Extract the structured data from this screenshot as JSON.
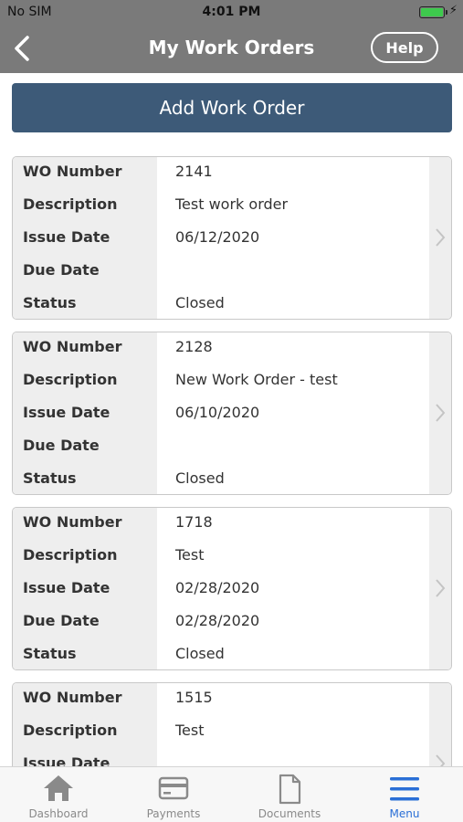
{
  "status_bar": {
    "carrier": "No SIM",
    "time": "4:01 PM",
    "charging_icon": "bolt-icon"
  },
  "nav": {
    "back_icon": "chevron-left-icon",
    "title": "My Work Orders",
    "help_label": "Help"
  },
  "add_button_label": "Add Work Order",
  "field_labels": {
    "wo_number": "WO Number",
    "description": "Description",
    "issue_date": "Issue Date",
    "due_date": "Due Date",
    "status": "Status"
  },
  "work_orders": [
    {
      "wo_number": "2141",
      "description": "Test work order",
      "issue_date": "06/12/2020",
      "due_date": "",
      "status": "Closed"
    },
    {
      "wo_number": "2128",
      "description": "New Work Order - test",
      "issue_date": "06/10/2020",
      "due_date": "",
      "status": "Closed"
    },
    {
      "wo_number": "1718",
      "description": "Test",
      "issue_date": "02/28/2020",
      "due_date": "02/28/2020",
      "status": "Closed"
    },
    {
      "wo_number": "1515",
      "description": "Test",
      "issue_date": "",
      "due_date": "",
      "status": ""
    }
  ],
  "tabs": [
    {
      "label": "Dashboard",
      "icon": "home-icon",
      "active": false
    },
    {
      "label": "Payments",
      "icon": "credit-card-icon",
      "active": false
    },
    {
      "label": "Documents",
      "icon": "document-icon",
      "active": false
    },
    {
      "label": "Menu",
      "icon": "menu-icon",
      "active": true
    }
  ],
  "colors": {
    "header_bg": "#7a7a7a",
    "primary_button": "#3d5a78",
    "active_tab": "#2a6fd6",
    "inactive_tab": "#8a8a8a"
  }
}
